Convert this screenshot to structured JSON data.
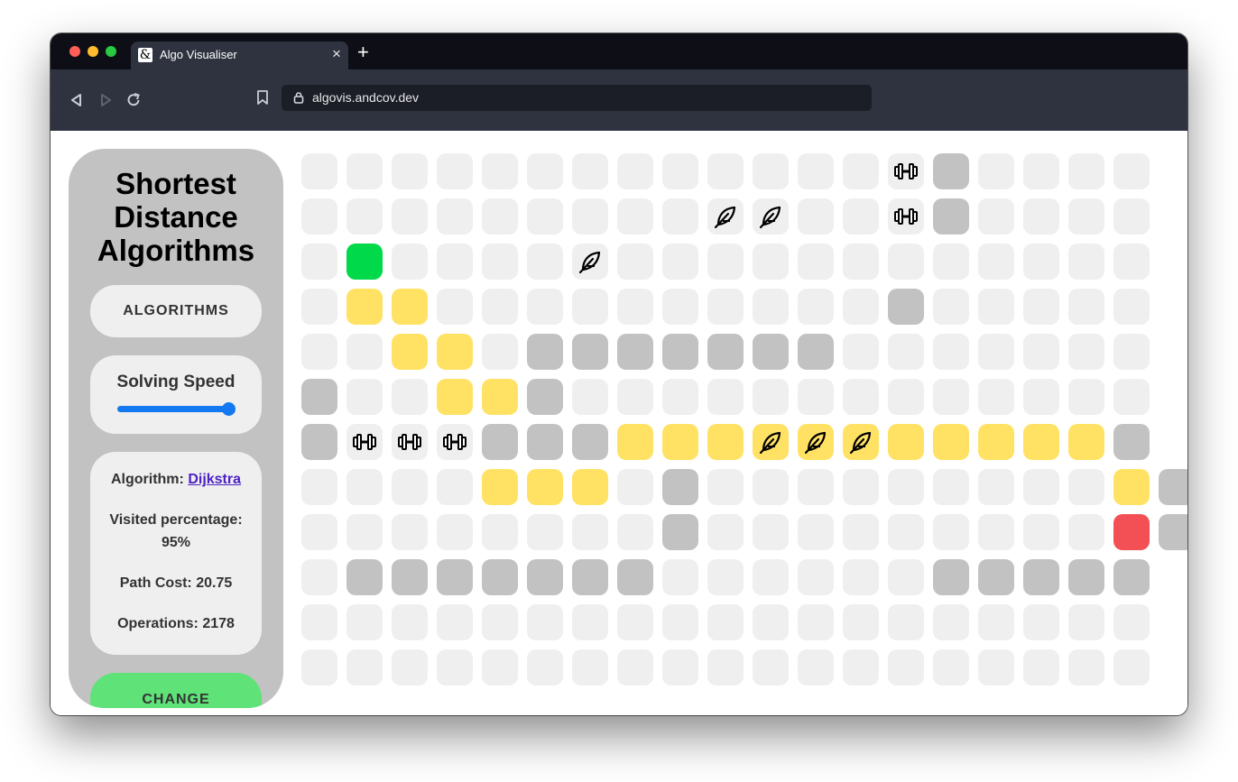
{
  "browser": {
    "tab_title": "Algo Visualiser",
    "favicon": "&",
    "url": "algovis.andcov.dev",
    "new_tab_icon": "plus-icon",
    "close_icon": "close-icon"
  },
  "sidebar": {
    "title": "Shortest Distance Algorithms",
    "algorithms_button": "ALGORITHMS",
    "speed_label": "Solving Speed",
    "speed_value": 1.0,
    "algorithm_label": "Algorithm:",
    "algorithm_name": "Dijkstra",
    "visited_label": "Visited percentage:",
    "visited_value": "95%",
    "path_cost": "Path Cost: 20.75",
    "operations": "Operations: 2178",
    "change_button": "CHANGE"
  },
  "colors": {
    "empty": "#efefef",
    "wall": "#c2c2c2",
    "path": "#ffe264",
    "start": "#00d94a",
    "end": "#f25054",
    "accent": "#1478f0"
  },
  "grid": {
    "cols": 19,
    "rows": 12,
    "legend": {
      ".": "empty",
      "#": "wall",
      "P": "path",
      "S": "start",
      "E": "end",
      "w": "weight-icon",
      "f": "feather-icon",
      "W": "path+weight-icon",
      "F": "path+feather-icon"
    },
    "cells": [
      ".............w#....",
      ".........ff..w#....",
      ".S....f............",
      ".PP..........#.....",
      "..PP.#######.......",
      "#..PP#.............",
      "#www###PPPFFFPPPPP#",
      "....PPP.#.........P#",
      "........#.........E#",
      ".#######......#####",
      "...................",
      "..................."
    ]
  }
}
